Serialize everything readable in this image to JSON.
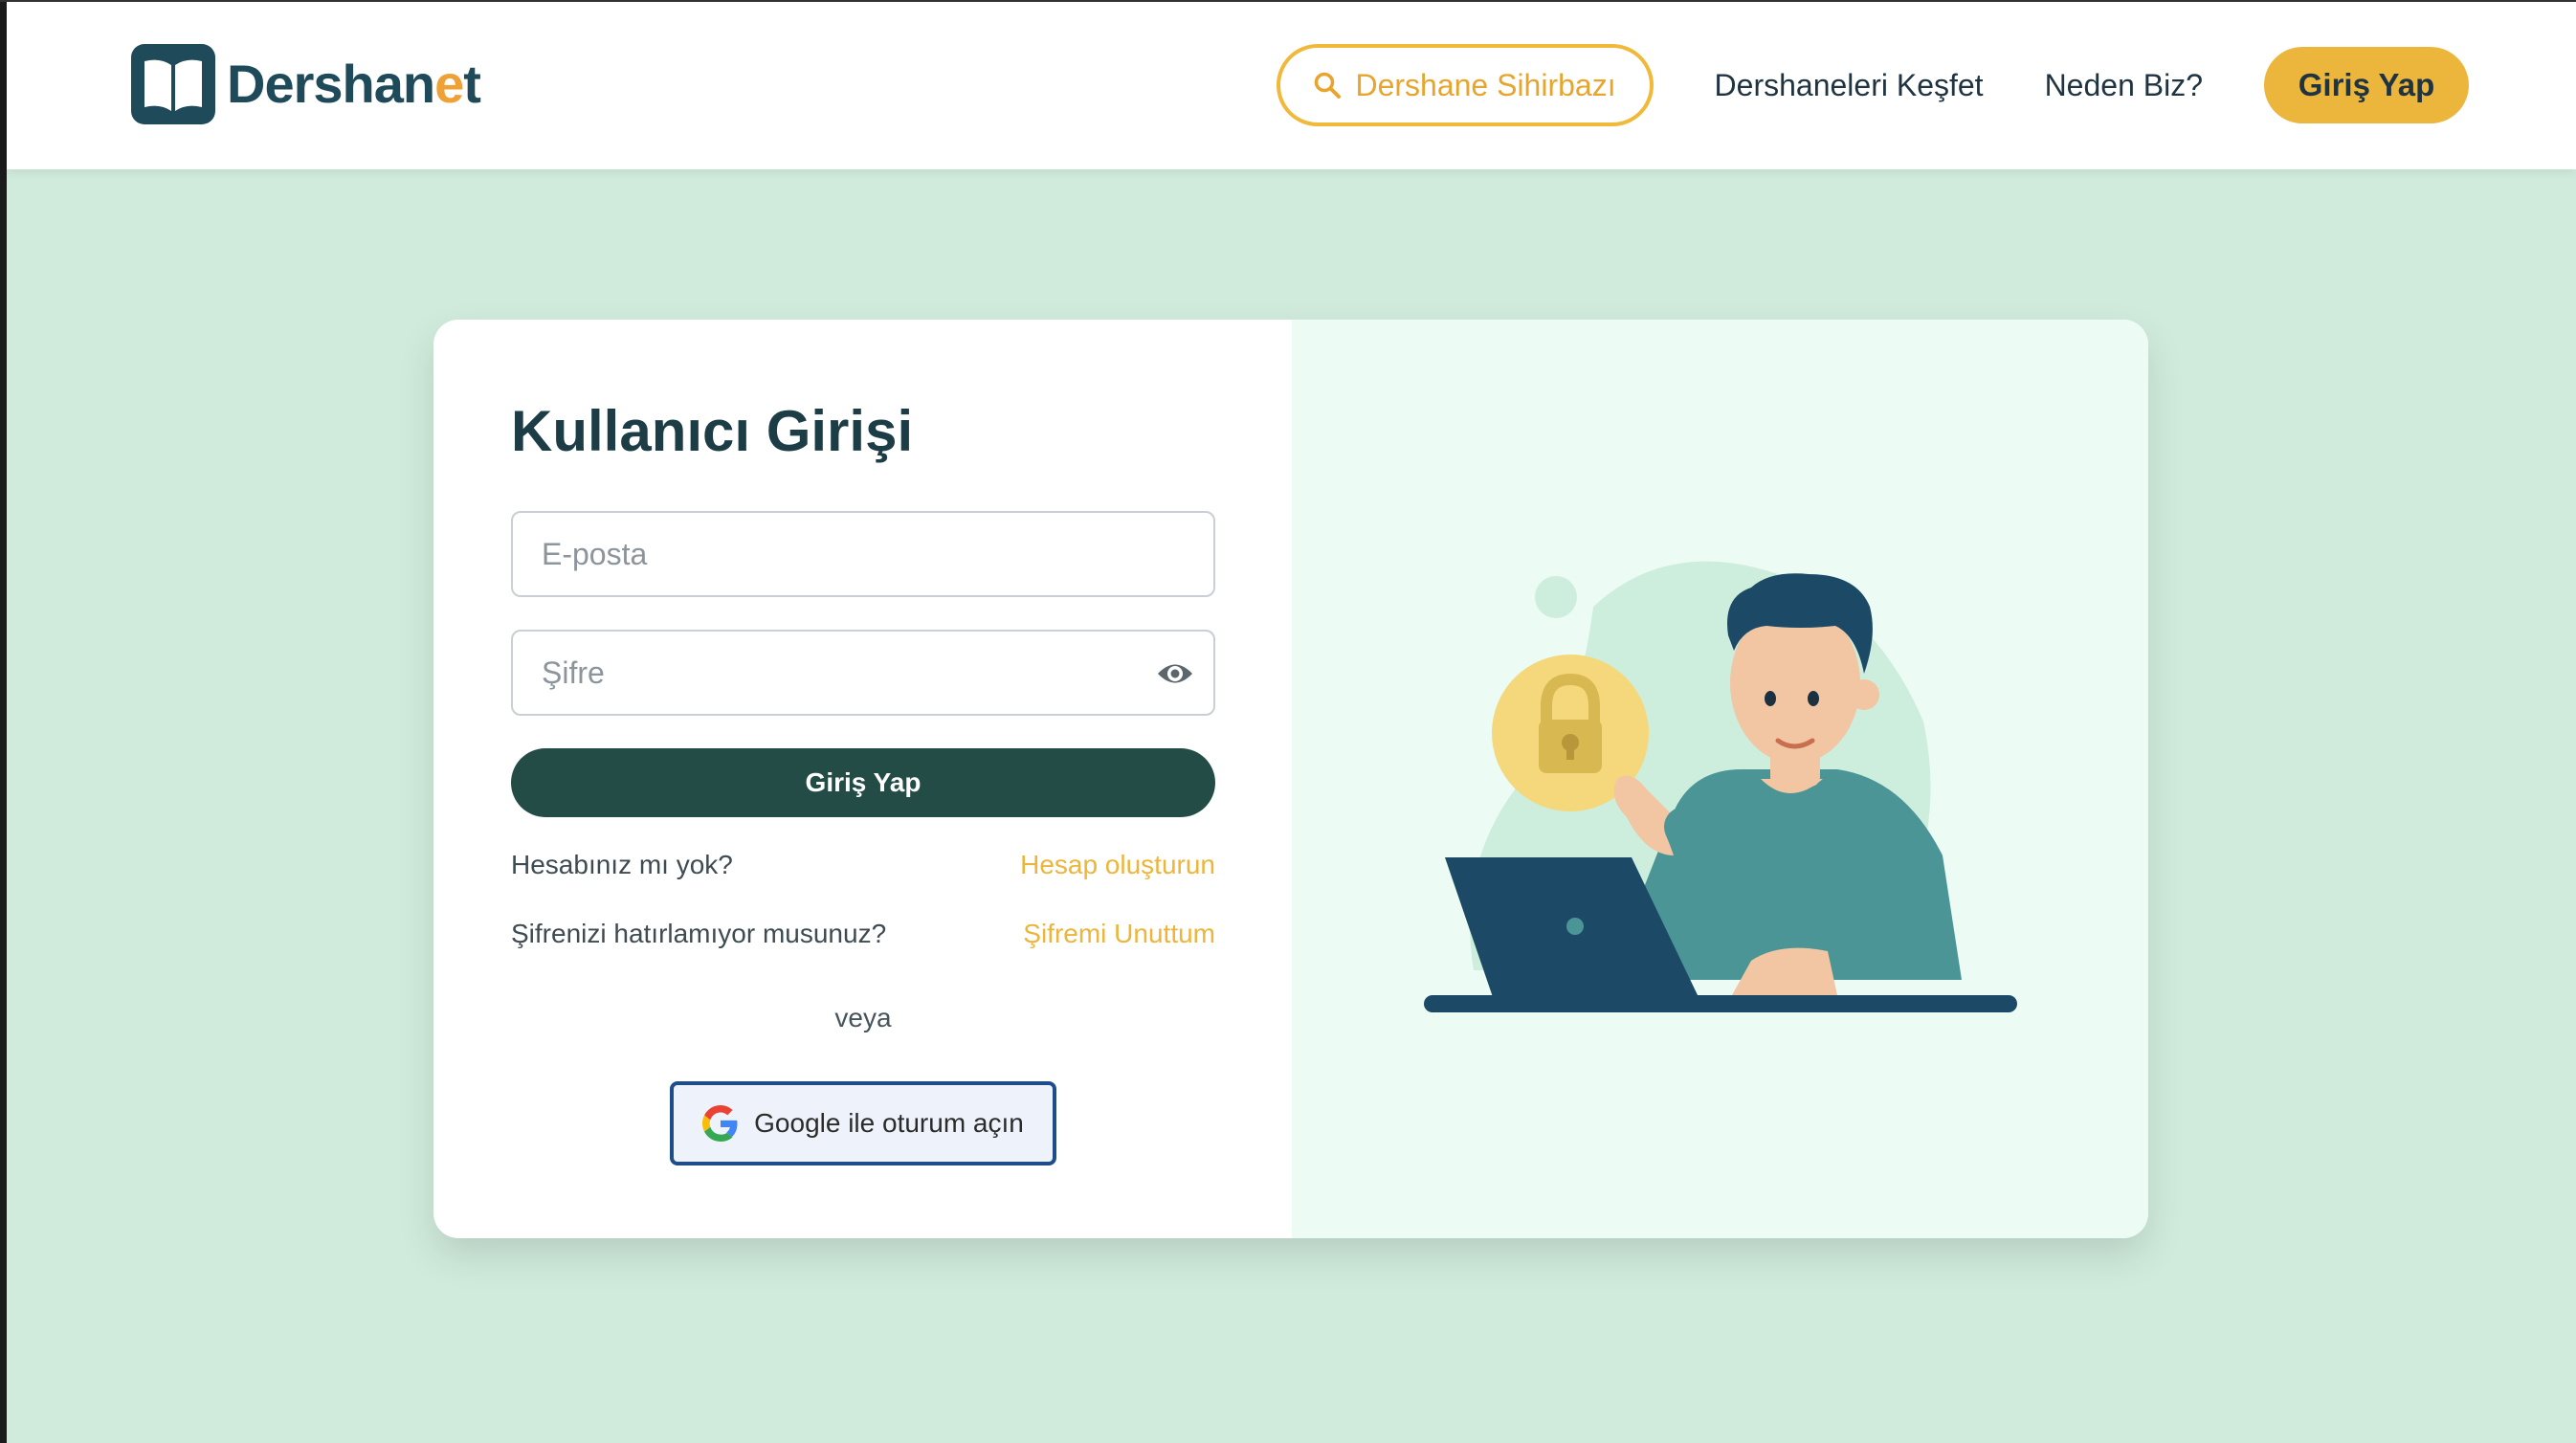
{
  "header": {
    "logo_text_main": "Dershan",
    "logo_text_accent": "e",
    "logo_text_end": "t",
    "wizard_label": "Dershane Sihirbazı",
    "discover_label": "Dershaneleri Keşfet",
    "why_label": "Neden Biz?",
    "login_label": "Giriş Yap"
  },
  "form": {
    "title": "Kullanıcı Girişi",
    "email_placeholder": "E-posta",
    "password_placeholder": "Şifre",
    "submit_label": "Giriş Yap",
    "no_account_text": "Hesabınız mı yok?",
    "create_account_link": "Hesap oluşturun",
    "forgot_text": "Şifrenizi hatırlamıyor musunuz?",
    "forgot_link": "Şifremi Unuttum",
    "or_text": "veya",
    "google_label": "Google ile oturum açın"
  },
  "colors": {
    "page_bg": "#d0ebdc",
    "brand_dark": "#1f4a5a",
    "accent": "#ecb53b",
    "button_dark": "#244c47",
    "illustration_bg": "#ecfcf4"
  },
  "icons": {
    "logo": "book-icon",
    "wizard": "search-icon",
    "password_toggle": "eye-icon",
    "google": "google-icon",
    "illustration": "man-with-laptop-and-lock-icon"
  }
}
